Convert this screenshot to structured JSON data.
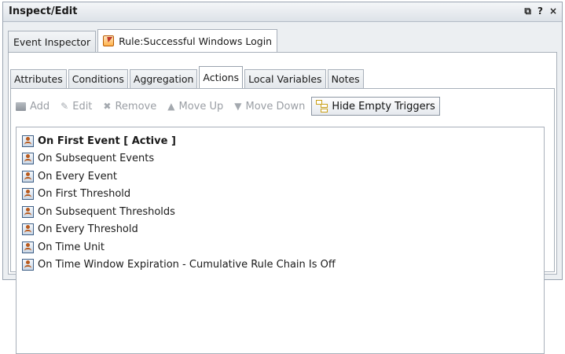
{
  "window": {
    "title": "Inspect/Edit",
    "controls": [
      "⧉",
      "?",
      "×"
    ]
  },
  "top_tabs": [
    {
      "label": "Event Inspector",
      "icon": null
    },
    {
      "label": "Rule:Successful Windows Login",
      "icon": "rule-icon"
    }
  ],
  "sub_tabs": [
    "Attributes",
    "Conditions",
    "Aggregation",
    "Actions",
    "Local Variables",
    "Notes"
  ],
  "active_sub_tab": "Actions",
  "toolbar": {
    "add": "Add",
    "edit": "Edit",
    "remove": "Remove",
    "move_up": "Move Up",
    "move_down": "Move Down",
    "hide_empty": "Hide Empty Triggers"
  },
  "triggers": [
    "On First Event [ Active ]",
    "On Subsequent Events",
    "On Every Event",
    "On First Threshold",
    "On Subsequent Thresholds",
    "On Every Threshold",
    "On Time Unit",
    "On Time Window Expiration - Cumulative Rule Chain Is Off"
  ]
}
